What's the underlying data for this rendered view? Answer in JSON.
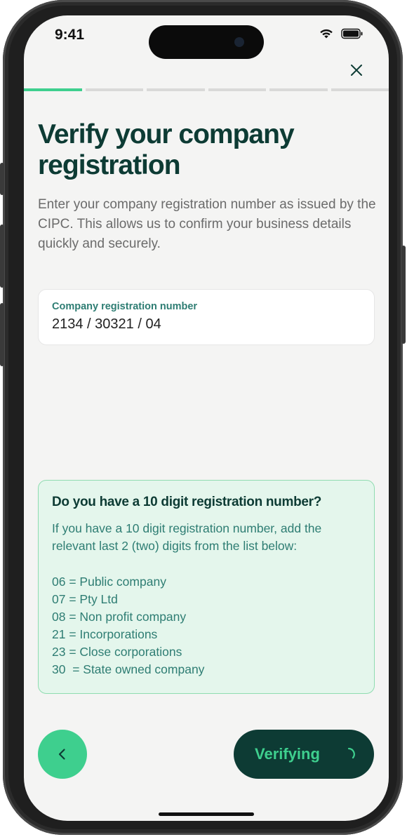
{
  "status_bar": {
    "time": "9:41"
  },
  "progress": {
    "total_steps": 6,
    "current_step": 1
  },
  "header": {
    "title": "Verify your company registration",
    "description": "Enter your company registration number as issued by the CIPC. This allows us to confirm your business details quickly and securely."
  },
  "form": {
    "registration_label": "Company registration number",
    "registration_value": "2134 / 30321 / 04"
  },
  "info": {
    "title": "Do you have a 10 digit registration number?",
    "body": "If you have a 10 digit registration number, add the relevant last 2 (two) digits from the list below:",
    "items": [
      "06 = Public company",
      "07 = Pty Ltd",
      "08 = Non profit company",
      "21 = Incorporations",
      "23 = Close corporations",
      "30  = State owned company"
    ]
  },
  "actions": {
    "verify_label": "Verifying"
  },
  "colors": {
    "accent": "#3ecf8e",
    "dark": "#0d3b34",
    "info_bg": "#e4f6ec",
    "teal_text": "#2e7d73"
  }
}
